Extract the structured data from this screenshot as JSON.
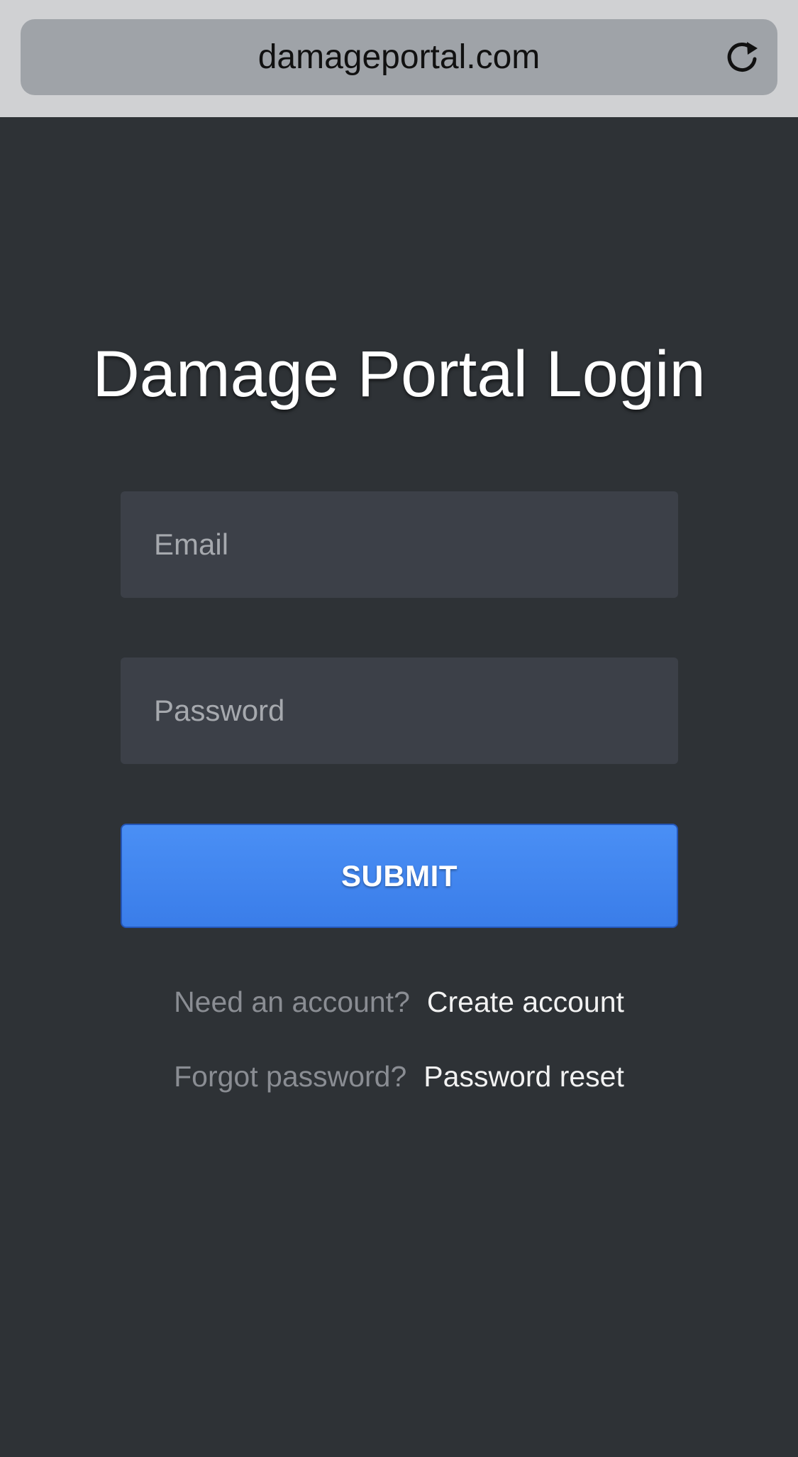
{
  "browser": {
    "url": "damageportal.com",
    "reload_icon": "reload-icon"
  },
  "login": {
    "title": "Damage Portal Login",
    "email_placeholder": "Email",
    "password_placeholder": "Password",
    "submit_label": "SUBMIT",
    "create_prompt": "Need an account?",
    "create_link": "Create account",
    "reset_prompt": "Forgot password?",
    "reset_link": "Password reset"
  },
  "colors": {
    "background": "#2e3236",
    "field_background": "#3c4048",
    "accent": "#3a7de9",
    "browser_chrome": "#d0d1d3",
    "url_field": "#9fa3a8"
  }
}
